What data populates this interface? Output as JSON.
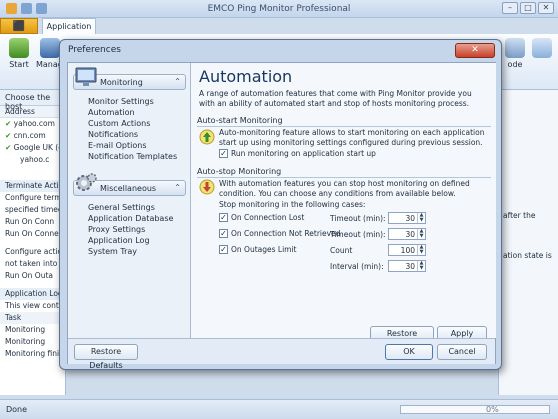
{
  "app": {
    "title": "EMCO Ping Monitor Professional",
    "file_tab": "⬛",
    "active_tab": "Application",
    "ribbon": [
      {
        "label": "Start"
      },
      {
        "label": "Manage Activity"
      }
    ],
    "ribbon_right": [
      {
        "label": "ode"
      }
    ],
    "left_pane": {
      "header": "Choose the host",
      "column": "Address",
      "rows": [
        "yahoo.com",
        "cnn.com",
        "Google UK (goo",
        "yahoo.c"
      ],
      "section": "Terminate Action",
      "lines": [
        "Configure termi",
        "specified timeou",
        "Run On Conn",
        "Run On Conne",
        "Configure actio",
        "not taken into a",
        "Run On Outa"
      ],
      "log_header": "Application Log",
      "log_lines": [
        "This view conta",
        "Task",
        "Monitoring",
        "Monitoring",
        "Monitoring finishe"
      ]
    },
    "right_pane": {
      "lines": [
        "after the",
        "ation state is"
      ]
    },
    "status": {
      "text": "Done",
      "progress_percent": "0%",
      "progress_value": 0
    },
    "colors": {
      "accent": "#1f4e86",
      "window": "#c6d6ea",
      "file_button": "#e5a020"
    }
  },
  "dialog": {
    "title": "Preferences",
    "close_icon": "close-icon",
    "nav": {
      "monitoring_header": "Monitoring",
      "monitoring_items": [
        "Monitor Settings",
        "Automation",
        "Custom Actions",
        "Notifications",
        "E-mail Options",
        "Notification Templates"
      ],
      "misc_header": "Miscellaneous",
      "misc_items": [
        "General Settings",
        "Application Database",
        "Proxy Settings",
        "Application Log",
        "System Tray"
      ]
    },
    "content": {
      "title": "Automation",
      "description": "A range of automation features that come with Ping Monitor provide you with an ability of automated start and stop of hosts monitoring process.",
      "auto_start": {
        "heading": "Auto-start Monitoring",
        "text": "Auto-monitoring feature allows to start monitoring on each application start up using monitoring settings configured during previous session.",
        "checkbox_label": "Run monitoring on application start up",
        "checked": true
      },
      "auto_stop": {
        "heading": "Auto-stop Monitoring",
        "text": "With automation features you can stop host monitoring on defined condition. You can choose any conditions from available below.",
        "prompt": "Stop monitoring in the following cases:",
        "conditions": [
          {
            "label": "On Connection Lost",
            "checked": true,
            "field_label": "Timeout (min):",
            "value": "30"
          },
          {
            "label": "On Connection Not Retrieved",
            "checked": true,
            "field_label": "Timeout (min):",
            "value": "30"
          },
          {
            "label": "On Outages Limit",
            "checked": true,
            "field_label": "Count",
            "value": "100"
          }
        ],
        "interval_label": "Interval (min):",
        "interval_value": "30"
      },
      "restore_defaults": "Restore Defaults",
      "apply": "Apply"
    },
    "footer": {
      "restore_defaults": "Restore Defaults",
      "ok": "OK",
      "cancel": "Cancel"
    }
  }
}
